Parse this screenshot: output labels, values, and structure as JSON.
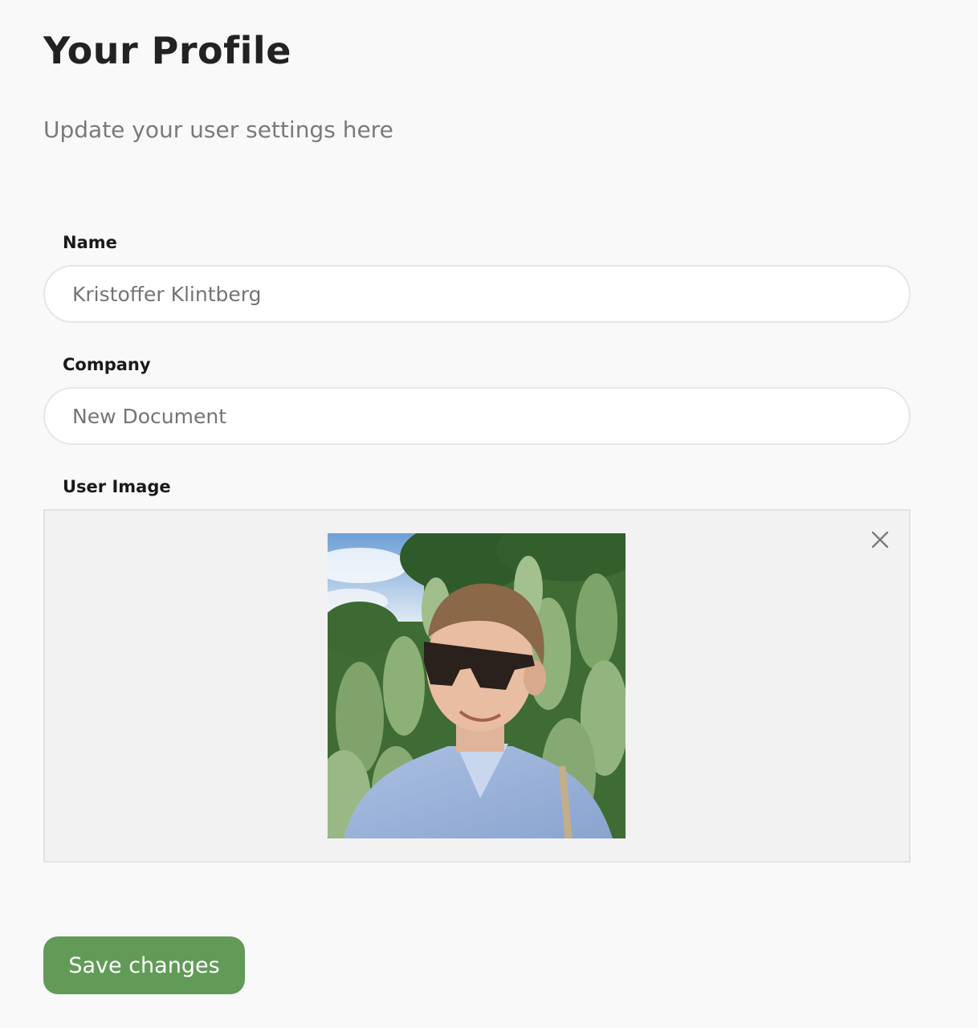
{
  "header": {
    "title": "Your Profile",
    "subtitle": "Update your user settings here"
  },
  "form": {
    "name": {
      "label": "Name",
      "value": "Kristoffer Klintberg"
    },
    "company": {
      "label": "Company",
      "value": "New Document"
    },
    "user_image": {
      "label": "User Image",
      "remove_icon": "close-icon"
    }
  },
  "actions": {
    "save_label": "Save changes"
  },
  "colors": {
    "background": "#f9f9f9",
    "accent": "#629b58",
    "field_border": "#e6e6e6",
    "dropzone_background": "#f2f2f2"
  }
}
